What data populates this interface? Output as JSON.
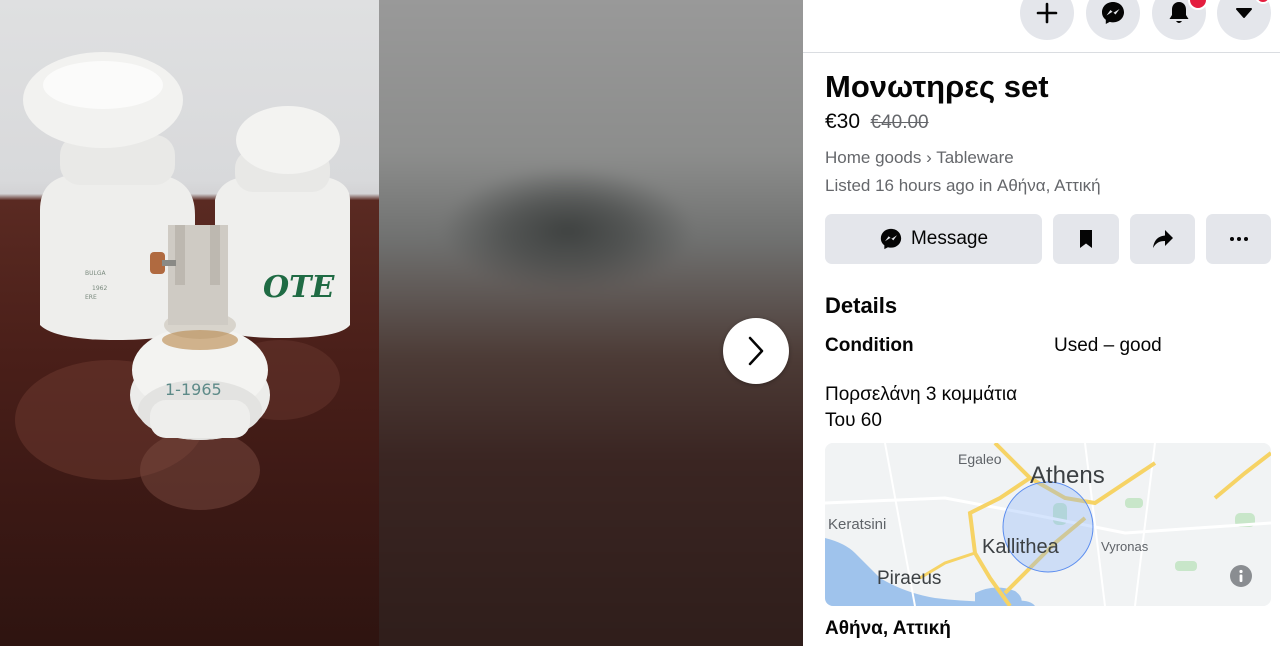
{
  "top_nav": {
    "create_icon": "plus-icon",
    "messenger_icon": "messenger-icon",
    "notifications_icon": "bell-icon",
    "account_icon": "caret-down-icon"
  },
  "media": {
    "photo_text": {
      "stamp_lines": [
        "BULGA",
        "1962",
        "ERE"
      ],
      "brand": "OTE",
      "year_mark": "1-1965"
    },
    "next_icon": "chevron-right-icon"
  },
  "listing": {
    "title": "Μονωτηρες set",
    "price": "€30",
    "old_price": "€40.00",
    "category": "Home goods",
    "separator": "›",
    "subcategory": "Tableware",
    "listed": "Listed 16 hours ago in Αθήνα, Αττική"
  },
  "actions": {
    "message_label": "Message",
    "message_icon": "messenger-icon",
    "save_icon": "bookmark-icon",
    "share_icon": "share-arrow-icon",
    "more_icon": "more-dots-icon"
  },
  "details": {
    "heading": "Details",
    "condition_label": "Condition",
    "condition_value": "Used – good",
    "description_line1": "Πορσελάνη 3 κομμάτια",
    "description_line2": "Του 60"
  },
  "map": {
    "labels": {
      "egaleo": "Egaleo",
      "athens": "Athens",
      "keratsini": "Keratsini",
      "kallithea": "Kallithea",
      "vyronas": "Vyronas",
      "piraeus": "Piraeus"
    },
    "info_icon": "info-icon"
  },
  "location": "Αθήνα, Αττική",
  "colors": {
    "accent": "#1877f2",
    "badge": "#e41e3f",
    "button_bg": "#e4e6eb",
    "text_primary": "#050505",
    "text_secondary": "#65676b"
  }
}
